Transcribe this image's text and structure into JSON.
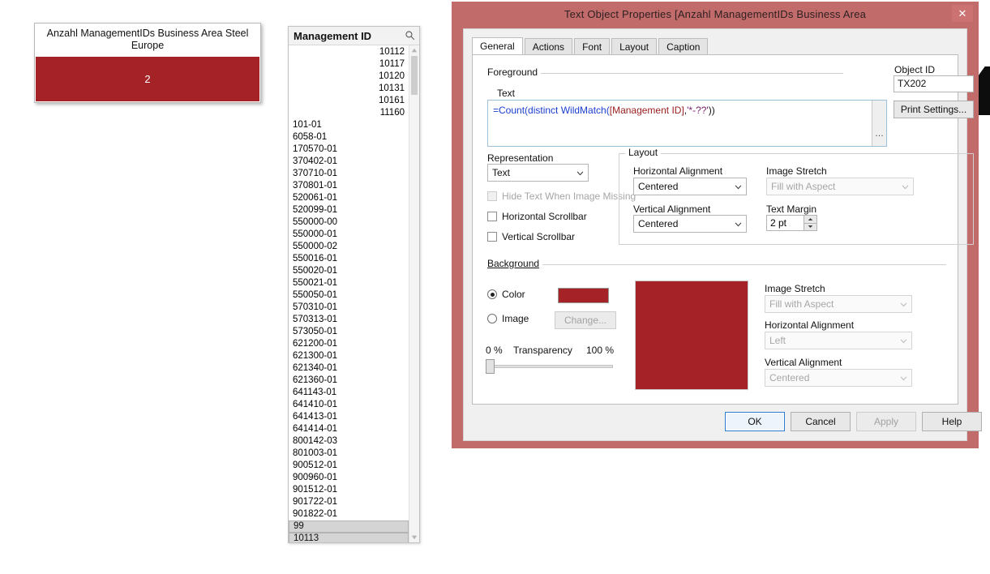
{
  "text_object": {
    "caption": "Anzahl ManagementIDs Business Area Steel Europe",
    "value": "2",
    "background_color": "#a52226",
    "text_color": "#ffffff"
  },
  "listbox": {
    "title": "Management ID",
    "search_icon": "magnifier-icon",
    "numeric_rows": [
      "10112",
      "10117",
      "10120",
      "10131",
      "10161",
      "11160"
    ],
    "text_rows": [
      "101-01",
      "6058-01",
      "170570-01",
      "370402-01",
      "370710-01",
      "370801-01",
      "520061-01",
      "520099-01",
      "550000-00",
      "550000-01",
      "550000-02",
      "550016-01",
      "550020-01",
      "550021-01",
      "550050-01",
      "570310-01",
      "570313-01",
      "573050-01",
      "621200-01",
      "621300-01",
      "621340-01",
      "621360-01",
      "641143-01",
      "641410-01",
      "641413-01",
      "641414-01",
      "800142-03",
      "801003-01",
      "900512-01",
      "900960-01",
      "901512-01",
      "901722-01",
      "901822-01"
    ],
    "selected_rows": [
      "99",
      "10113"
    ]
  },
  "dialog": {
    "title": "Text Object Properties [Anzahl ManagementIDs Business Area",
    "close_label": "✕",
    "frame_color": "#c26b6b",
    "tabs": [
      {
        "label": "General",
        "active": true
      },
      {
        "label": "Actions",
        "active": false
      },
      {
        "label": "Font",
        "active": false
      },
      {
        "label": "Layout",
        "active": false
      },
      {
        "label": "Caption",
        "active": false
      }
    ],
    "foreground": {
      "group_label": "Foreground",
      "text_label": "Text",
      "expression": "=Count(distinct WildMatch([Management ID],'*-??'))",
      "expression_tokens": [
        {
          "t": "=Count(",
          "c": "kw"
        },
        {
          "t": "distinct ",
          "c": "kw"
        },
        {
          "t": "WildMatch(",
          "c": "kw"
        },
        {
          "t": "[Management ID]",
          "c": "fld"
        },
        {
          "t": ",",
          "c": "pln"
        },
        {
          "t": "'*-??'",
          "c": "str"
        },
        {
          "t": "))",
          "c": "pln"
        }
      ],
      "expand_button": "…"
    },
    "object_id": {
      "label": "Object ID",
      "value": "TX202",
      "print_settings_label": "Print Settings..."
    },
    "representation": {
      "label": "Representation",
      "value": "Text",
      "hide_text_when_image_missing": {
        "label": "Hide Text When Image Missing",
        "checked": false,
        "disabled": true
      },
      "horizontal_scrollbar": {
        "label": "Horizontal Scrollbar",
        "checked": false,
        "disabled": false
      },
      "vertical_scrollbar": {
        "label": "Vertical Scrollbar",
        "checked": false,
        "disabled": false
      }
    },
    "layout": {
      "group_label": "Layout",
      "horizontal_alignment": {
        "label": "Horizontal Alignment",
        "value": "Centered",
        "disabled": false
      },
      "vertical_alignment": {
        "label": "Vertical Alignment",
        "value": "Centered",
        "disabled": false
      },
      "image_stretch": {
        "label": "Image Stretch",
        "value": "Fill with Aspect",
        "disabled": true
      },
      "text_margin": {
        "label": "Text Margin",
        "value": "2 pt"
      }
    },
    "background": {
      "group_label": "Background",
      "color_radio": {
        "label": "Color",
        "selected": true
      },
      "image_radio": {
        "label": "Image",
        "selected": false
      },
      "change_button": {
        "label": "Change...",
        "disabled": true
      },
      "swatch_color": "#a52226",
      "preview_color": "#a52226",
      "transparency": {
        "label": "Transparency",
        "min_label": "0 %",
        "max_label": "100 %",
        "value": 0
      },
      "image_stretch": {
        "label": "Image Stretch",
        "value": "Fill with Aspect",
        "disabled": true
      },
      "horizontal_alignment": {
        "label": "Horizontal Alignment",
        "value": "Left",
        "disabled": true
      },
      "vertical_alignment": {
        "label": "Vertical Alignment",
        "value": "Centered",
        "disabled": true
      }
    },
    "buttons": {
      "ok": {
        "label": "OK",
        "focused": true,
        "disabled": false
      },
      "cancel": {
        "label": "Cancel",
        "focused": false,
        "disabled": false
      },
      "apply": {
        "label": "Apply",
        "focused": false,
        "disabled": true
      },
      "help": {
        "label": "Help",
        "focused": false,
        "disabled": false
      }
    }
  }
}
